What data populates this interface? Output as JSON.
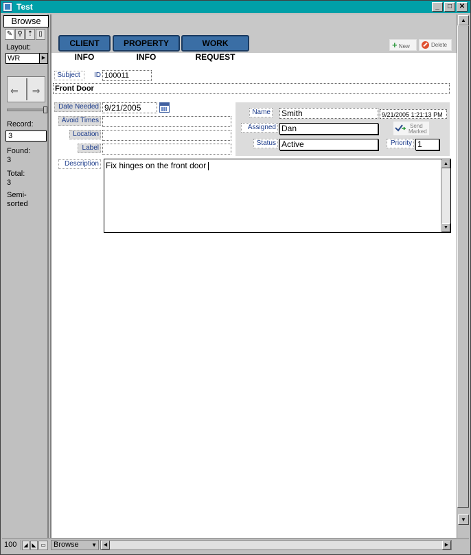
{
  "window": {
    "title": "Test"
  },
  "statusArea": {
    "mode": "Browse",
    "layout_label": "Layout:",
    "layout_value": "WR",
    "record_label": "Record:",
    "record_value": "3",
    "found_label": "Found:",
    "found_value": "3",
    "total_label": "Total:",
    "total_value": "3",
    "sort_status": "Semi-sorted"
  },
  "tabs": [
    {
      "label": "CLIENT INFO"
    },
    {
      "label": "PROPERTY INFO"
    },
    {
      "label": "WORK REQUEST"
    }
  ],
  "actions": {
    "new_label": "New",
    "delete_label": "Delete"
  },
  "form": {
    "subject_label": "Subject",
    "id_label": "ID",
    "id_value": "100011",
    "subject_value": "Front Door",
    "date_needed_label": "Date Needed",
    "date_needed_value": "9/21/2005",
    "avoid_times_label": "Avoid Times",
    "avoid_times_value": "",
    "location_label": "Location",
    "location_value": "",
    "label_label": "Label",
    "label_value": "",
    "name_label": "Name",
    "name_value": "Smith",
    "timestamp_value": "9/21/2005 1:21:13 PM",
    "assigned_label": "Assigned",
    "assigned_value": "Dan",
    "send_label_1": "Send",
    "send_label_2": "Marked",
    "status_label": "Status",
    "status_value": "Active",
    "priority_label": "Priority",
    "priority_value": "1",
    "description_label": "Description",
    "description_value": "Fix hinges on the front door"
  },
  "bottomBar": {
    "zoom": "100",
    "mode": "Browse"
  },
  "colors": {
    "titlebar": "#00a0a8",
    "tab": "#3a6ea5",
    "label_text": "#1a3a8a"
  }
}
